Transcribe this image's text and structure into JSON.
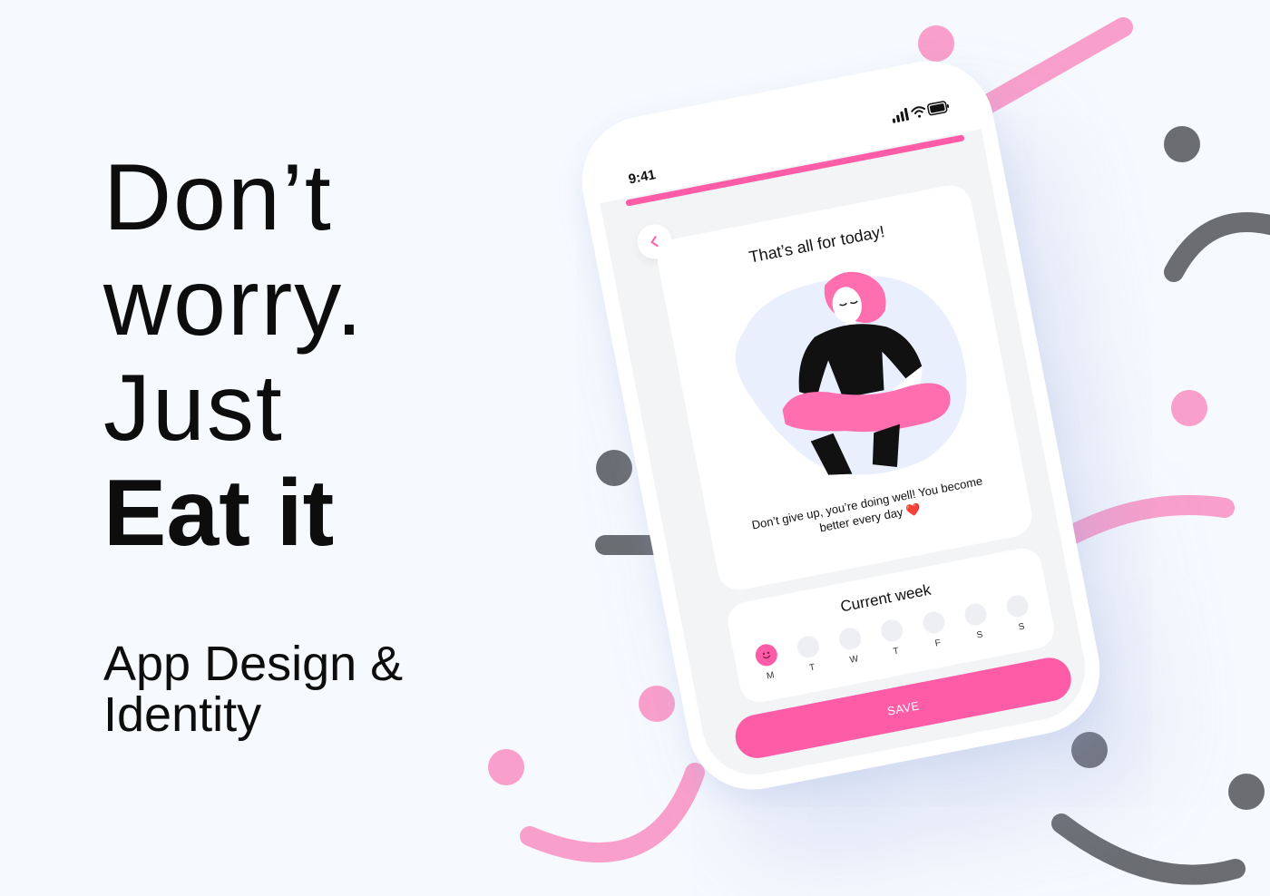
{
  "headline": {
    "line1": "Don’t",
    "line2": "worry.",
    "line3": "Just",
    "line4": "Eat it"
  },
  "subheadline": {
    "line1": "App Design &",
    "line2": "Identity"
  },
  "phone": {
    "status_bar": {
      "time": "9:41"
    },
    "progress": {
      "fraction": 1.0
    },
    "card": {
      "title": "That’s all for today!",
      "message": "Don’t give up, you’re doing well! You become better every day ❤️"
    },
    "week": {
      "title": "Current week",
      "days": [
        {
          "label": "M",
          "active": true
        },
        {
          "label": "T",
          "active": false
        },
        {
          "label": "W",
          "active": false
        },
        {
          "label": "T",
          "active": false
        },
        {
          "label": "F",
          "active": false
        },
        {
          "label": "S",
          "active": false
        },
        {
          "label": "S",
          "active": false
        }
      ]
    },
    "save_label": "SAVE"
  },
  "colors": {
    "accent_pink": "#ff5ca8",
    "light_pink": "#f99fcb",
    "dark_gray": "#6b6d72",
    "background": "#f6f9fe"
  },
  "icons": [
    "back-chevron-icon",
    "signal-icon",
    "wifi-icon",
    "battery-icon",
    "smiley-icon"
  ]
}
